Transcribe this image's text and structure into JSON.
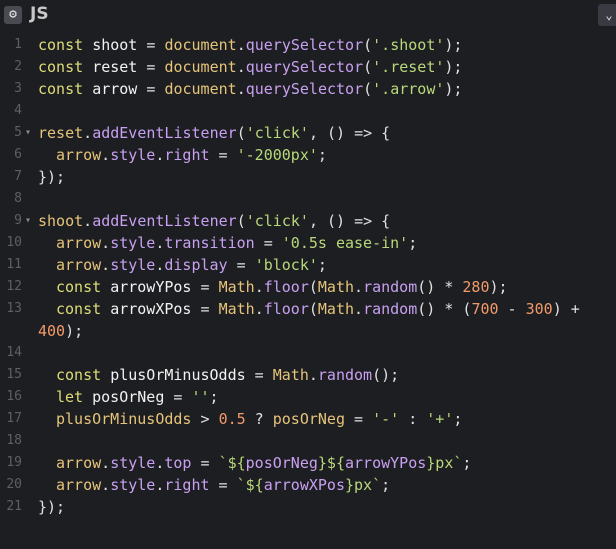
{
  "panel": {
    "title": "JS",
    "settings_icon": "gear-icon",
    "collapse_icon": "chevron-down-icon"
  },
  "code": {
    "lines": [
      {
        "n": "1",
        "fold": false,
        "indent": 0,
        "tokens": [
          [
            "kw",
            "const "
          ],
          [
            "var",
            "shoot"
          ],
          [
            "op",
            " = "
          ],
          [
            "obj",
            "document"
          ],
          [
            "op",
            "."
          ],
          [
            "fn",
            "querySelector"
          ],
          [
            "op",
            "("
          ],
          [
            "str",
            "'.shoot'"
          ],
          [
            "op",
            ");"
          ]
        ]
      },
      {
        "n": "2",
        "fold": false,
        "indent": 0,
        "tokens": [
          [
            "kw",
            "const "
          ],
          [
            "var",
            "reset"
          ],
          [
            "op",
            " = "
          ],
          [
            "obj",
            "document"
          ],
          [
            "op",
            "."
          ],
          [
            "fn",
            "querySelector"
          ],
          [
            "op",
            "("
          ],
          [
            "str",
            "'.reset'"
          ],
          [
            "op",
            ");"
          ]
        ]
      },
      {
        "n": "3",
        "fold": false,
        "indent": 0,
        "tokens": [
          [
            "kw",
            "const "
          ],
          [
            "var",
            "arrow"
          ],
          [
            "op",
            " = "
          ],
          [
            "obj",
            "document"
          ],
          [
            "op",
            "."
          ],
          [
            "fn",
            "querySelector"
          ],
          [
            "op",
            "("
          ],
          [
            "str",
            "'.arrow'"
          ],
          [
            "op",
            ");"
          ]
        ]
      },
      {
        "n": "4",
        "fold": false,
        "indent": 0,
        "tokens": []
      },
      {
        "n": "5",
        "fold": true,
        "indent": 0,
        "tokens": [
          [
            "obj",
            "reset"
          ],
          [
            "op",
            "."
          ],
          [
            "fn",
            "addEventListener"
          ],
          [
            "op",
            "("
          ],
          [
            "str",
            "'click'"
          ],
          [
            "op",
            ", () => {"
          ]
        ]
      },
      {
        "n": "6",
        "fold": false,
        "indent": 1,
        "tokens": [
          [
            "obj",
            "arrow"
          ],
          [
            "op",
            "."
          ],
          [
            "fn",
            "style"
          ],
          [
            "op",
            "."
          ],
          [
            "fn",
            "right"
          ],
          [
            "op",
            " = "
          ],
          [
            "str",
            "'-2000px'"
          ],
          [
            "op",
            ";"
          ]
        ]
      },
      {
        "n": "7",
        "fold": false,
        "indent": 0,
        "tokens": [
          [
            "op",
            "});"
          ]
        ]
      },
      {
        "n": "8",
        "fold": false,
        "indent": 0,
        "tokens": []
      },
      {
        "n": "9",
        "fold": true,
        "indent": 0,
        "tokens": [
          [
            "obj",
            "shoot"
          ],
          [
            "op",
            "."
          ],
          [
            "fn",
            "addEventListener"
          ],
          [
            "op",
            "("
          ],
          [
            "str",
            "'click'"
          ],
          [
            "op",
            ", () => {"
          ]
        ]
      },
      {
        "n": "10",
        "fold": false,
        "indent": 1,
        "tokens": [
          [
            "obj",
            "arrow"
          ],
          [
            "op",
            "."
          ],
          [
            "fn",
            "style"
          ],
          [
            "op",
            "."
          ],
          [
            "fn",
            "transition"
          ],
          [
            "op",
            " = "
          ],
          [
            "str",
            "'0.5s ease-in'"
          ],
          [
            "op",
            ";"
          ]
        ]
      },
      {
        "n": "11",
        "fold": false,
        "indent": 1,
        "tokens": [
          [
            "obj",
            "arrow"
          ],
          [
            "op",
            "."
          ],
          [
            "fn",
            "style"
          ],
          [
            "op",
            "."
          ],
          [
            "fn",
            "display"
          ],
          [
            "op",
            " = "
          ],
          [
            "str",
            "'block'"
          ],
          [
            "op",
            ";"
          ]
        ]
      },
      {
        "n": "12",
        "fold": false,
        "indent": 1,
        "tokens": [
          [
            "kw",
            "const "
          ],
          [
            "var",
            "arrowYPos"
          ],
          [
            "op",
            " = "
          ],
          [
            "obj",
            "Math"
          ],
          [
            "op",
            "."
          ],
          [
            "fn",
            "floor"
          ],
          [
            "op",
            "("
          ],
          [
            "obj",
            "Math"
          ],
          [
            "op",
            "."
          ],
          [
            "fn",
            "random"
          ],
          [
            "op",
            "() * "
          ],
          [
            "num",
            "280"
          ],
          [
            "op",
            ");"
          ]
        ]
      },
      {
        "n": "13",
        "fold": false,
        "indent": 1,
        "tokens": [
          [
            "kw",
            "const "
          ],
          [
            "var",
            "arrowXPos"
          ],
          [
            "op",
            " = "
          ],
          [
            "obj",
            "Math"
          ],
          [
            "op",
            "."
          ],
          [
            "fn",
            "floor"
          ],
          [
            "op",
            "("
          ],
          [
            "obj",
            "Math"
          ],
          [
            "op",
            "."
          ],
          [
            "fn",
            "random"
          ],
          [
            "op",
            "() * ("
          ],
          [
            "num",
            "700"
          ],
          [
            "op",
            " - "
          ],
          [
            "num",
            "300"
          ],
          [
            "op",
            ") +"
          ]
        ]
      },
      {
        "n": "",
        "fold": false,
        "indent": 0,
        "tokens": [
          [
            "num",
            "400"
          ],
          [
            "op",
            ");"
          ]
        ]
      },
      {
        "n": "14",
        "fold": false,
        "indent": 0,
        "tokens": []
      },
      {
        "n": "15",
        "fold": false,
        "indent": 1,
        "tokens": [
          [
            "kw",
            "const "
          ],
          [
            "var",
            "plusOrMinusOdds"
          ],
          [
            "op",
            " = "
          ],
          [
            "obj",
            "Math"
          ],
          [
            "op",
            "."
          ],
          [
            "fn",
            "random"
          ],
          [
            "op",
            "();"
          ]
        ]
      },
      {
        "n": "16",
        "fold": false,
        "indent": 1,
        "tokens": [
          [
            "kw",
            "let "
          ],
          [
            "var",
            "posOrNeg"
          ],
          [
            "op",
            " = "
          ],
          [
            "str",
            "''"
          ],
          [
            "op",
            ";"
          ]
        ]
      },
      {
        "n": "17",
        "fold": false,
        "indent": 1,
        "tokens": [
          [
            "obj",
            "plusOrMinusOdds"
          ],
          [
            "op",
            " > "
          ],
          [
            "num",
            "0.5"
          ],
          [
            "op",
            " ? "
          ],
          [
            "obj",
            "posOrNeg"
          ],
          [
            "op",
            " = "
          ],
          [
            "str",
            "'-'"
          ],
          [
            "op",
            " : "
          ],
          [
            "str",
            "'+'"
          ],
          [
            "op",
            ";"
          ]
        ]
      },
      {
        "n": "18",
        "fold": false,
        "indent": 0,
        "tokens": []
      },
      {
        "n": "19",
        "fold": false,
        "indent": 1,
        "tokens": [
          [
            "obj",
            "arrow"
          ],
          [
            "op",
            "."
          ],
          [
            "fn",
            "style"
          ],
          [
            "op",
            "."
          ],
          [
            "fn",
            "top"
          ],
          [
            "op",
            " = "
          ],
          [
            "tmp",
            "`${"
          ],
          [
            "interp",
            "posOrNeg"
          ],
          [
            "tmp",
            "}${"
          ],
          [
            "interp",
            "arrowYPos"
          ],
          [
            "tmp",
            "}px`"
          ],
          [
            "op",
            ";"
          ]
        ]
      },
      {
        "n": "20",
        "fold": false,
        "indent": 1,
        "tokens": [
          [
            "obj",
            "arrow"
          ],
          [
            "op",
            "."
          ],
          [
            "fn",
            "style"
          ],
          [
            "op",
            "."
          ],
          [
            "fn",
            "right"
          ],
          [
            "op",
            " = "
          ],
          [
            "tmp",
            "`${"
          ],
          [
            "interp",
            "arrowXPos"
          ],
          [
            "tmp",
            "}px`"
          ],
          [
            "op",
            ";"
          ]
        ]
      },
      {
        "n": "21",
        "fold": false,
        "indent": 0,
        "tokens": [
          [
            "op",
            "});"
          ]
        ]
      }
    ]
  }
}
